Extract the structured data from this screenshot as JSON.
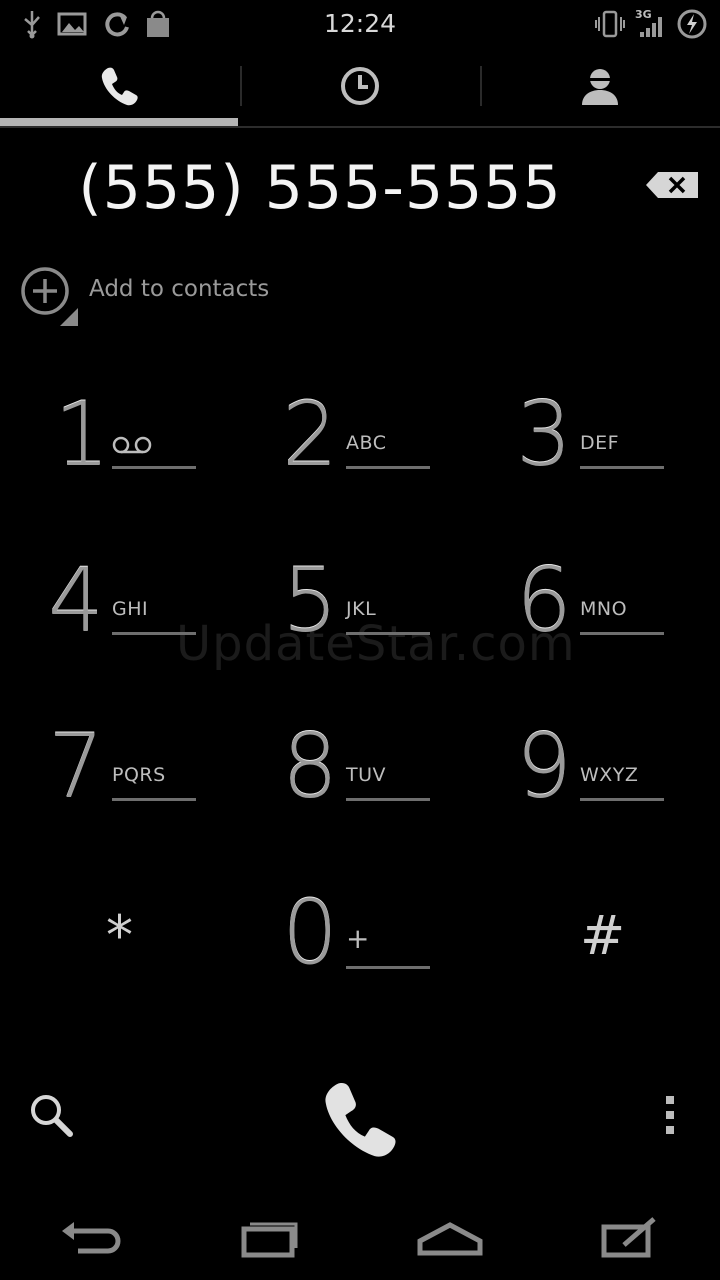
{
  "status_bar": {
    "time": "12:24",
    "network_type": "3G",
    "left_icons": [
      "usb-icon",
      "image-icon",
      "sync-icon",
      "shopping-bag-icon"
    ],
    "right_icons": [
      "vibrate-icon",
      "signal-icon",
      "battery-charging-icon"
    ]
  },
  "tabs": [
    {
      "name": "phone-icon",
      "selected": true
    },
    {
      "name": "clock-icon",
      "selected": false
    },
    {
      "name": "contact-icon",
      "selected": false
    }
  ],
  "dialer": {
    "number": "(555) 555-5555",
    "add_to_contacts": "Add to contacts"
  },
  "keypad": {
    "keys": [
      {
        "digit": "1",
        "letters": ""
      },
      {
        "digit": "2",
        "letters": "ABC"
      },
      {
        "digit": "3",
        "letters": "DEF"
      },
      {
        "digit": "4",
        "letters": "GHI"
      },
      {
        "digit": "5",
        "letters": "JKL"
      },
      {
        "digit": "6",
        "letters": "MNO"
      },
      {
        "digit": "7",
        "letters": "PQRS"
      },
      {
        "digit": "8",
        "letters": "TUV"
      },
      {
        "digit": "9",
        "letters": "WXYZ"
      },
      {
        "digit": "*",
        "letters": ""
      },
      {
        "digit": "0",
        "letters": "+"
      },
      {
        "digit": "#",
        "letters": ""
      }
    ]
  },
  "watermark": "UpdateStar.com",
  "colors": {
    "background": "#000000",
    "text_primary": "#f4f4f4",
    "text_secondary": "#9a9a9a",
    "tab_indicator": "#b4b4b4"
  }
}
